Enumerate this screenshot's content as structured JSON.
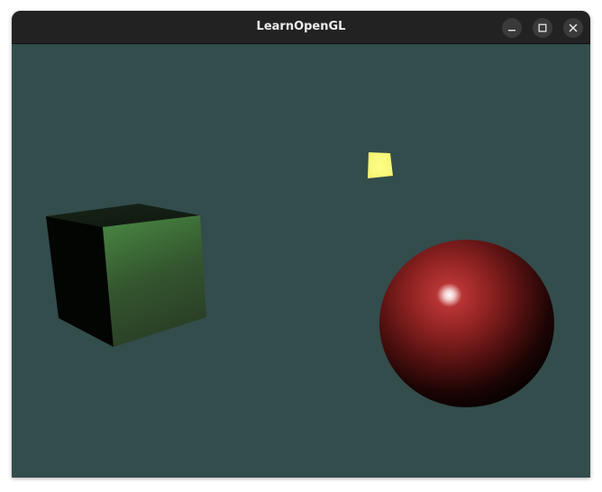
{
  "window": {
    "title": "LearnOpenGL",
    "controls": {
      "minimize_icon": "minimize-icon",
      "maximize_icon": "maximize-icon",
      "close_icon": "close-icon"
    }
  },
  "scene": {
    "clear_color": "#334c4c",
    "cube_color": "#4a8a44",
    "sphere_color": "#a82a2a",
    "light_color": "#ffff80"
  }
}
